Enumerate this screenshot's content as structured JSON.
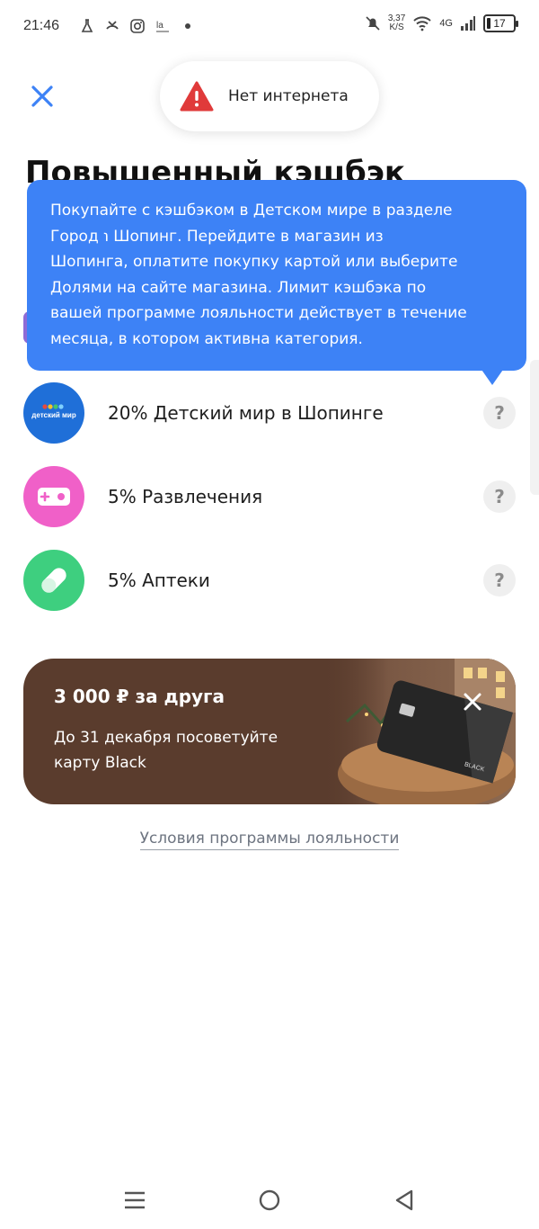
{
  "status_bar": {
    "time": "21:46",
    "speed_value": "3,37",
    "speed_unit": "K/S",
    "network": "4G",
    "battery": "17",
    "left_icons": [
      "lab-flask-icon",
      "missed-call-icon",
      "instagram-icon",
      "gallery-icon",
      "dot-icon"
    ],
    "right_icons": [
      "mute-bell-icon",
      "wifi-icon",
      "signal-icon",
      "battery-icon"
    ]
  },
  "header": {
    "title": "Повышенный кэшбэк"
  },
  "toast": {
    "icon": "warning-icon",
    "text": "Нет интернета"
  },
  "tooltip": {
    "lines": [
      "Покупайте с кэшбэком в Детском мире в разделе",
      "Город ℩ Шопинг. Перейдите в магазин из",
      "Шопинга, оплатите покупку картой или выберите",
      "Долями на сайте магазина. Лимит кэшбэка по",
      "вашей программе лояльности действует в течение",
      "месяца, в котором активна категория."
    ]
  },
  "categories": [
    {
      "label": "20% Детский мир в Шопинге",
      "icon": "detsky-mir-icon",
      "icon_text": "детский мир",
      "color": "#1f6fd8",
      "help": "?"
    },
    {
      "label": "5% Развлечения",
      "icon": "gamepad-icon",
      "color": "#f060c8",
      "help": "?"
    },
    {
      "label": "5% Аптеки",
      "icon": "pill-icon",
      "color": "#3ecf7f",
      "help": "?"
    }
  ],
  "promo": {
    "title": "3 000 ₽ за друга",
    "description": "До 31 декабря посоветуйте карту Black",
    "card_label": "BLACK",
    "close": "close-icon"
  },
  "terms_link": "Условия программы лояльности",
  "nav": [
    "menu-icon",
    "home-icon",
    "back-icon"
  ],
  "colors": {
    "tooltip_bg": "#3d82f6",
    "close_blue": "#3d82f6",
    "promo_bg": "#5a3c2d",
    "warning_red": "#e03a3a"
  }
}
